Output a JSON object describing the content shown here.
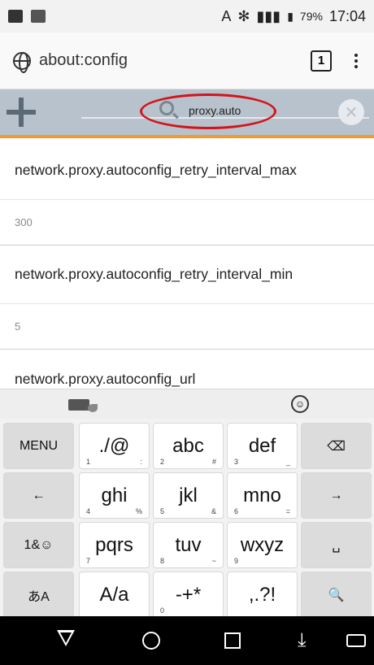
{
  "status_bar": {
    "battery": "79%",
    "time": "17:04"
  },
  "url_bar": {
    "url": "about:config",
    "tab_count": "1"
  },
  "search": {
    "query": "proxy.auto"
  },
  "prefs": [
    {
      "name": "network.proxy.autoconfig_retry_interval_max",
      "value": "300"
    },
    {
      "name": "network.proxy.autoconfig_retry_interval_min",
      "value": "5"
    },
    {
      "name": "network.proxy.autoconfig_url",
      "value": ""
    }
  ],
  "keyboard": {
    "keys": [
      {
        "label": "MENU",
        "sub": "",
        "subr": "",
        "side": true
      },
      {
        "label": "./@",
        "sub": "1",
        "subr": ":",
        "side": false
      },
      {
        "label": "abc",
        "sub": "2",
        "subr": "#",
        "side": false
      },
      {
        "label": "def",
        "sub": "3",
        "subr": "_",
        "side": false
      },
      {
        "label": "⌫",
        "sub": "",
        "subr": "",
        "side": true
      },
      {
        "label": "←",
        "sub": "",
        "subr": "",
        "side": true
      },
      {
        "label": "ghi",
        "sub": "4",
        "subr": "%",
        "side": false
      },
      {
        "label": "jkl",
        "sub": "5",
        "subr": "&",
        "side": false
      },
      {
        "label": "mno",
        "sub": "6",
        "subr": "=",
        "side": false
      },
      {
        "label": "→",
        "sub": "",
        "subr": "",
        "side": true
      },
      {
        "label": "1&☺",
        "sub": "",
        "subr": "",
        "side": true
      },
      {
        "label": "pqrs",
        "sub": "7",
        "subr": "",
        "side": false
      },
      {
        "label": "tuv",
        "sub": "8",
        "subr": "~",
        "side": false
      },
      {
        "label": "wxyz",
        "sub": "9",
        "subr": "",
        "side": false
      },
      {
        "label": "␣",
        "sub": "",
        "subr": "",
        "side": true
      },
      {
        "label": "あA",
        "sub": "",
        "subr": "",
        "side": true
      },
      {
        "label": "A/a",
        "sub": "",
        "subr": "",
        "side": false
      },
      {
        "label": "-+*",
        "sub": "0",
        "subr": "",
        "side": false
      },
      {
        "label": ",.?!",
        "sub": "",
        "subr": "",
        "side": false
      },
      {
        "label": "🔍",
        "sub": "",
        "subr": "",
        "side": true
      }
    ]
  }
}
